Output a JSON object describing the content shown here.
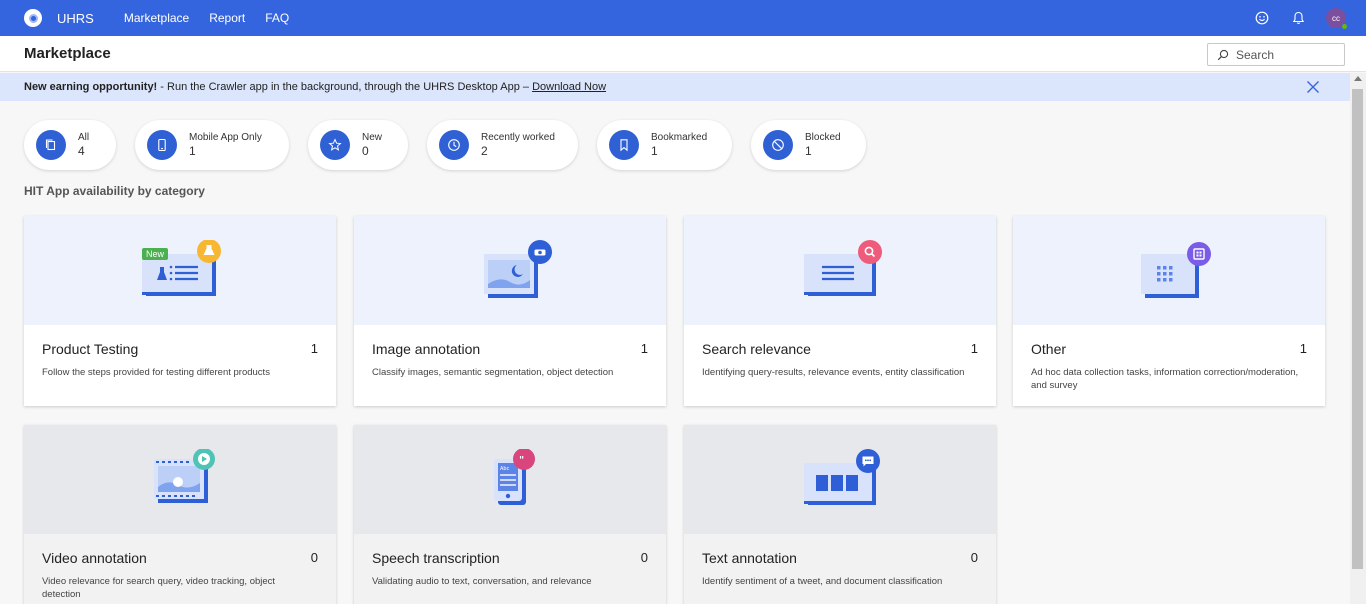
{
  "topbar": {
    "brand": "UHRS",
    "nav": [
      "Marketplace",
      "Report",
      "FAQ"
    ],
    "avatar_initials": "cc",
    "accent": "#3465de"
  },
  "header": {
    "title": "Marketplace",
    "search_placeholder": "Search"
  },
  "banner": {
    "bold": "New earning opportunity!",
    "text": " - Run the Crawler app in the background, through the UHRS Desktop App – ",
    "link": "Download Now"
  },
  "filters": [
    {
      "label": "All",
      "count": "4",
      "icon": "copy-icon"
    },
    {
      "label": "Mobile App Only",
      "count": "1",
      "icon": "phone-icon"
    },
    {
      "label": "New",
      "count": "0",
      "icon": "star-icon"
    },
    {
      "label": "Recently worked",
      "count": "2",
      "icon": "clock-icon"
    },
    {
      "label": "Bookmarked",
      "count": "1",
      "icon": "bookmark-icon"
    },
    {
      "label": "Blocked",
      "count": "1",
      "icon": "blocked-icon"
    }
  ],
  "section_title": "HIT App availability by category",
  "categories": [
    {
      "title": "Product Testing",
      "count": "1",
      "desc": "Follow the steps provided for testing different products",
      "badge": "New",
      "icon": "flask-icon"
    },
    {
      "title": "Image annotation",
      "count": "1",
      "desc": "Classify images, semantic segmentation, object detection",
      "icon": "image-icon"
    },
    {
      "title": "Search relevance",
      "count": "1",
      "desc": "Identifying query-results, relevance events, entity classification",
      "icon": "search-icon"
    },
    {
      "title": "Other",
      "count": "1",
      "desc": "Ad hoc data collection tasks, information correction/moderation, and survey",
      "icon": "grid-icon"
    },
    {
      "title": "Video annotation",
      "count": "0",
      "desc": "Video relevance for search query, video tracking, object detection",
      "icon": "play-icon"
    },
    {
      "title": "Speech transcription",
      "count": "0",
      "desc": "Validating audio to text, conversation, and relevance",
      "icon": "quote-icon"
    },
    {
      "title": "Text annotation",
      "count": "0",
      "desc": "Identify sentiment of a tweet, and document classification",
      "icon": "chat-icon"
    }
  ]
}
